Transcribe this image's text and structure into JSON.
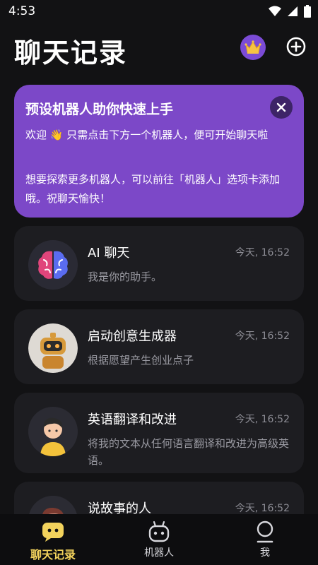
{
  "status_bar": {
    "time": "4:53"
  },
  "header": {
    "title": "聊天记录"
  },
  "banner": {
    "title": "预设机器人助你快速上手",
    "line1": "欢迎 👋 只需点击下方一个机器人，便可开始聊天啦",
    "line2": "想要探索更多机器人，可以前往「机器人」选项卡添加哦。祝聊天愉快！"
  },
  "chats": [
    {
      "name": "AI 聊天",
      "time": "今天, 16:52",
      "desc": "我是你的助手。"
    },
    {
      "name": "启动创意生成器",
      "time": "今天, 16:52",
      "desc": "根据愿望产生创业点子"
    },
    {
      "name": "英语翻译和改进",
      "time": "今天, 16:52",
      "desc": "将我的文本从任何语言翻译和改进为高级英语。"
    },
    {
      "name": "说故事的人",
      "time": "今天, 16:52",
      "desc": ""
    }
  ],
  "tabbar": {
    "items": [
      {
        "label": "聊天记录"
      },
      {
        "label": "机器人"
      },
      {
        "label": "我"
      }
    ]
  },
  "colors": {
    "accent": "#7c48c8",
    "active_tab": "#f2d25c",
    "background": "#121214",
    "card": "#1d1d21"
  }
}
